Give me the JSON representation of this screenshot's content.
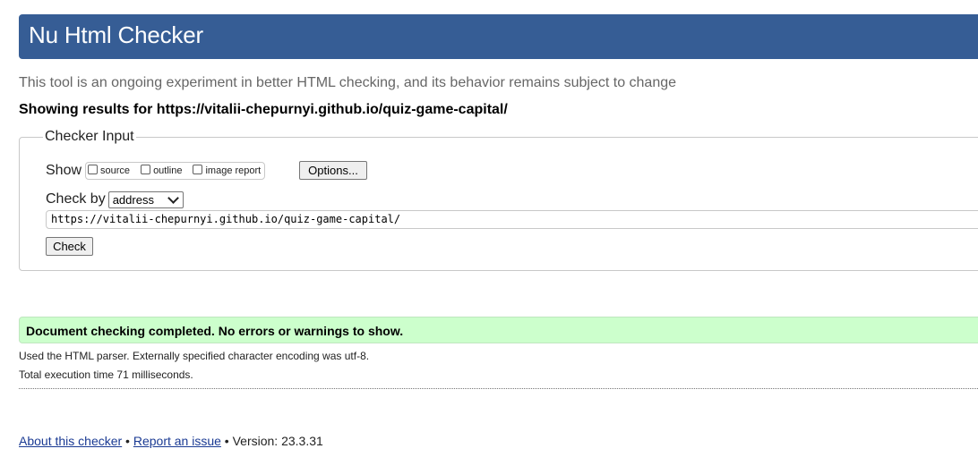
{
  "header": {
    "title": "Nu Html Checker",
    "bg_color": "#365d95"
  },
  "tagline": "This tool is an ongoing experiment in better HTML checking, and its behavior remains subject to change",
  "showing_results": "Showing results for https://vitalii-chepurnyi.github.io/quiz-game-capital/",
  "checker_input": {
    "legend": "Checker Input",
    "show_label": "Show",
    "show_options": [
      {
        "label": "source",
        "checked": false
      },
      {
        "label": "outline",
        "checked": false
      },
      {
        "label": "image report",
        "checked": false
      }
    ],
    "options_button": "Options...",
    "check_by_label": "Check by",
    "check_by_value": "address",
    "url_value": "https://vitalii-chepurnyi.github.io/quiz-game-capital/",
    "check_button": "Check"
  },
  "result": {
    "message": "Document checking completed. No errors or warnings to show.",
    "bg_color": "#ccffcc"
  },
  "details": {
    "parser": "Used the HTML parser. Externally specified character encoding was utf-8.",
    "execution": "Total execution time 71 milliseconds."
  },
  "footer": {
    "about_link": "About this checker",
    "sep1": " • ",
    "report_link": "Report an issue",
    "sep2": " • ",
    "version": "Version: 23.3.31",
    "link_color": "#1a3a93"
  }
}
